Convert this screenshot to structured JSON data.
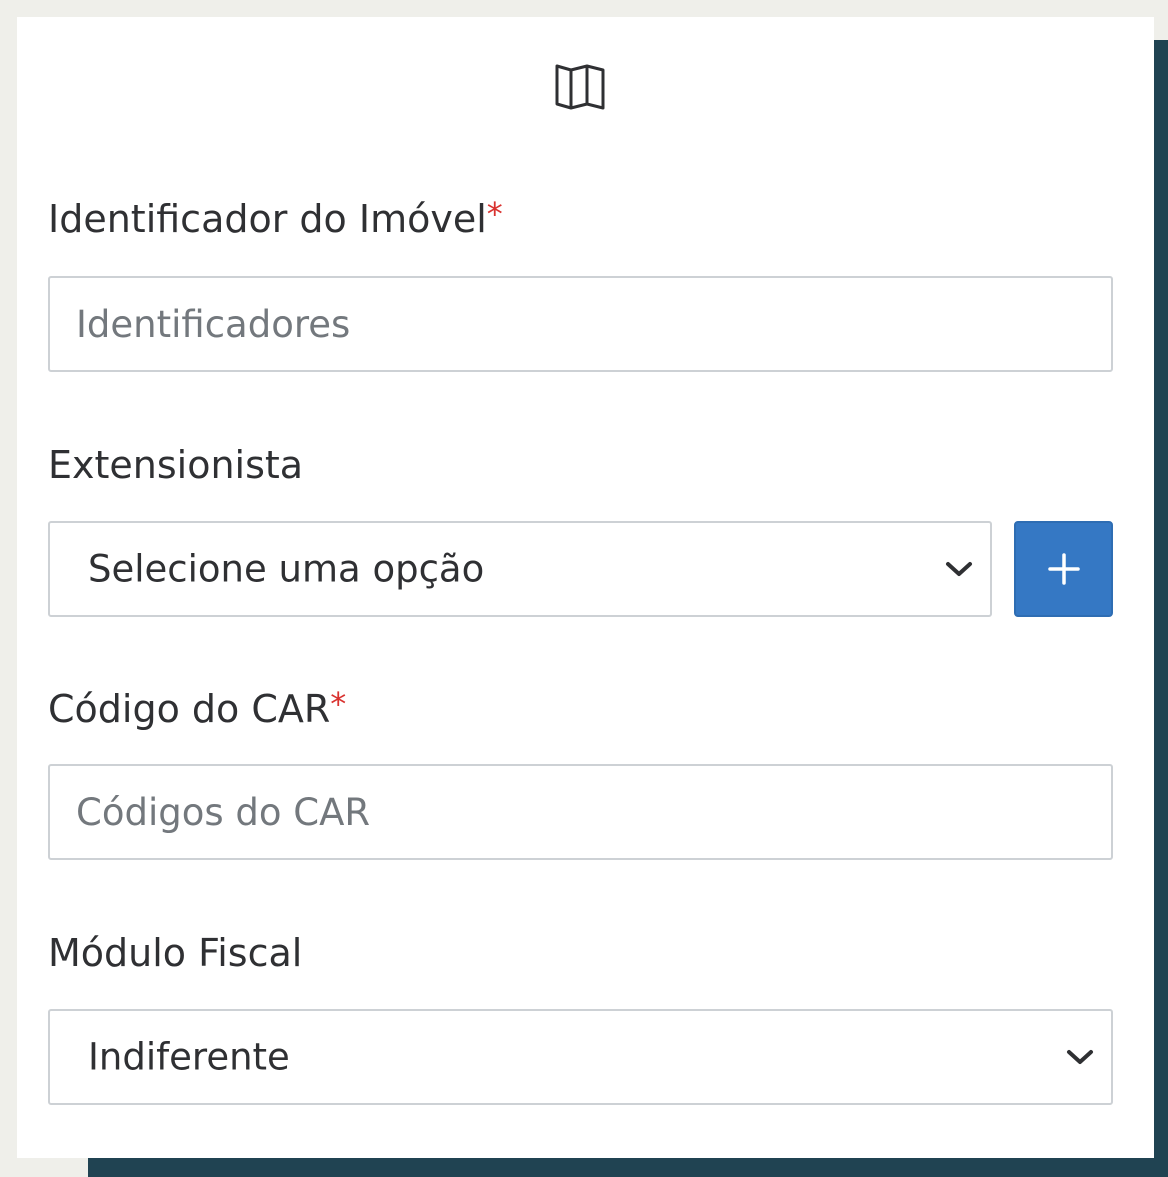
{
  "form": {
    "header_icon": "map-icon",
    "identificador": {
      "label": "Identificador do Imóvel",
      "required_mark": "*",
      "placeholder": "Identificadores",
      "value": ""
    },
    "extensionista": {
      "label": "Extensionista",
      "selected": "Selecione uma opção",
      "add_icon": "plus-icon",
      "dropdown_icon": "chevron-down-icon"
    },
    "codigo_car": {
      "label": "Código do CAR",
      "required_mark": "*",
      "placeholder": "Códigos do CAR",
      "value": ""
    },
    "modulo_fiscal": {
      "label": "Módulo Fiscal",
      "selected": "Indiferente",
      "dropdown_icon": "chevron-down-icon"
    }
  },
  "colors": {
    "accent": "#3578c4",
    "required": "#d9322f",
    "backdrop": "#204352",
    "page_background": "#efefea"
  }
}
